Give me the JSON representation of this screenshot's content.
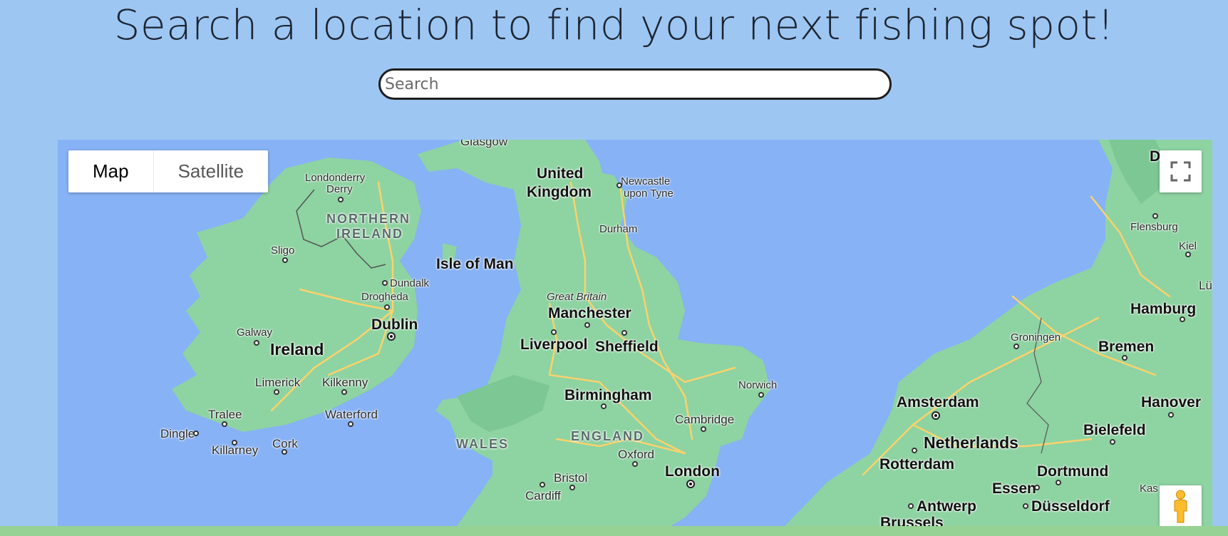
{
  "header": {
    "title": "Search a location to find your next fishing spot!"
  },
  "search": {
    "placeholder": "Search",
    "value": ""
  },
  "map": {
    "type_controls": {
      "map": "Map",
      "satellite": "Satellite",
      "active": "Map"
    },
    "controls": {
      "fullscreen_icon": "fullscreen-icon",
      "pegman_icon": "pegman-icon"
    },
    "colors": {
      "water": "#87b2f5",
      "land": "#8ed3a2",
      "land_dark": "#7cc794",
      "road": "#fbd26b",
      "page_bg": "#9dc6f3",
      "footer": "#96d294"
    },
    "labels": {
      "glasgow": "Glasgow",
      "united_kingdom_1": "United",
      "united_kingdom_2": "Kingdom",
      "newcastle_1": "Newcastle",
      "newcastle_2": "upon Tyne",
      "durham": "Durham",
      "londonderry_1": "Londonderry",
      "londonderry_2": "Derry",
      "northern_ireland_1": "NORTHERN",
      "northern_ireland_2": "IRELAND",
      "sligo": "Sligo",
      "isle_of_man": "Isle of Man",
      "dundalk": "Dundalk",
      "drogheda": "Drogheda",
      "great_britain": "Great Britain",
      "manchester": "Manchester",
      "dublin": "Dublin",
      "galway": "Galway",
      "ireland": "Ireland",
      "liverpool": "Liverpool",
      "sheffield": "Sheffield",
      "limerick": "Limerick",
      "kilkenny": "Kilkenny",
      "birmingham": "Birmingham",
      "norwich": "Norwich",
      "tralee": "Tralee",
      "waterford": "Waterford",
      "dingle": "Dingle",
      "cork": "Cork",
      "killarney": "Killarney",
      "wales": "WALES",
      "england": "ENGLAND",
      "cambridge": "Cambridge",
      "oxford": "Oxford",
      "london": "London",
      "bristol": "Bristol",
      "cardiff": "Cardiff",
      "flensburg": "Flensburg",
      "kiel": "Kiel",
      "lub": "Lüb",
      "hamburg": "Hamburg",
      "groningen": "Groningen",
      "bremen": "Bremen",
      "amsterdam": "Amsterdam",
      "hanover": "Hanover",
      "bielefeld": "Bielefeld",
      "netherlands": "Netherlands",
      "rotterdam": "Rotterdam",
      "dortmund": "Dortmund",
      "essen": "Essen",
      "kas": "Kas",
      "antwerp": "Antwerp",
      "dusseldorf": "Düsseldorf",
      "brussels": "Brussels",
      "den": "Den"
    }
  }
}
